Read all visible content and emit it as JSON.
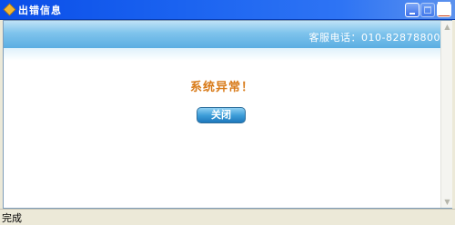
{
  "window": {
    "title": "出错信息",
    "title_icon": "app-diamond-icon",
    "controls": {
      "minimize": "minimize-icon",
      "maximize": "maximize-icon",
      "close": "close-icon",
      "close_glyph": "✕"
    }
  },
  "header": {
    "service_label": "客服电话：010-82878800"
  },
  "main": {
    "message": "系统异常！",
    "close_button_label": "关闭"
  },
  "status_bar": {
    "text": "完成"
  },
  "colors": {
    "titlebar": "#0a4ee8",
    "header_band": "#5aaee2",
    "message": "#d87a18",
    "button": "#1d78bc"
  }
}
